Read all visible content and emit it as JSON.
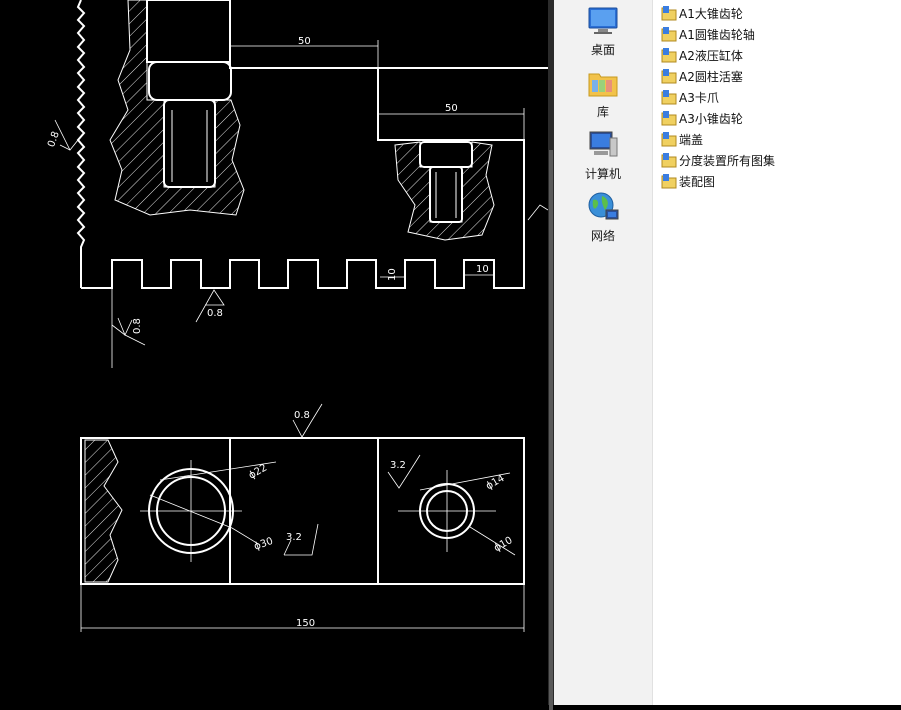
{
  "cad": {
    "dims": {
      "d50_top": "50",
      "d50_mid": "50",
      "d10_tooth": "10",
      "d10_side": "10",
      "d150": "150",
      "dia22": "ϕ22",
      "dia30": "ϕ30",
      "dia14": "ϕ14",
      "dia10": "ϕ10"
    },
    "roughness": {
      "r08_left": "0.8",
      "r08_bottom": "0.8",
      "r08_side": "0.8",
      "r08_plan": "0.8",
      "r32_mid": "3.2",
      "r32_right": "3.2"
    }
  },
  "nav": {
    "items": [
      {
        "label": "桌面",
        "icon": "desktop-icon"
      },
      {
        "label": "库",
        "icon": "library-icon"
      },
      {
        "label": "计算机",
        "icon": "computer-icon"
      },
      {
        "label": "网络",
        "icon": "network-icon"
      }
    ]
  },
  "files": {
    "items": [
      {
        "label": "A1大锥齿轮"
      },
      {
        "label": "A1圆锥齿轮轴"
      },
      {
        "label": "A2液压缸体"
      },
      {
        "label": "A2圆柱活塞"
      },
      {
        "label": "A3卡爪"
      },
      {
        "label": "A3小锥齿轮"
      },
      {
        "label": "端盖"
      },
      {
        "label": "分度装置所有图集"
      },
      {
        "label": "装配图"
      }
    ],
    "icon": "autocad-drawing-icon"
  }
}
